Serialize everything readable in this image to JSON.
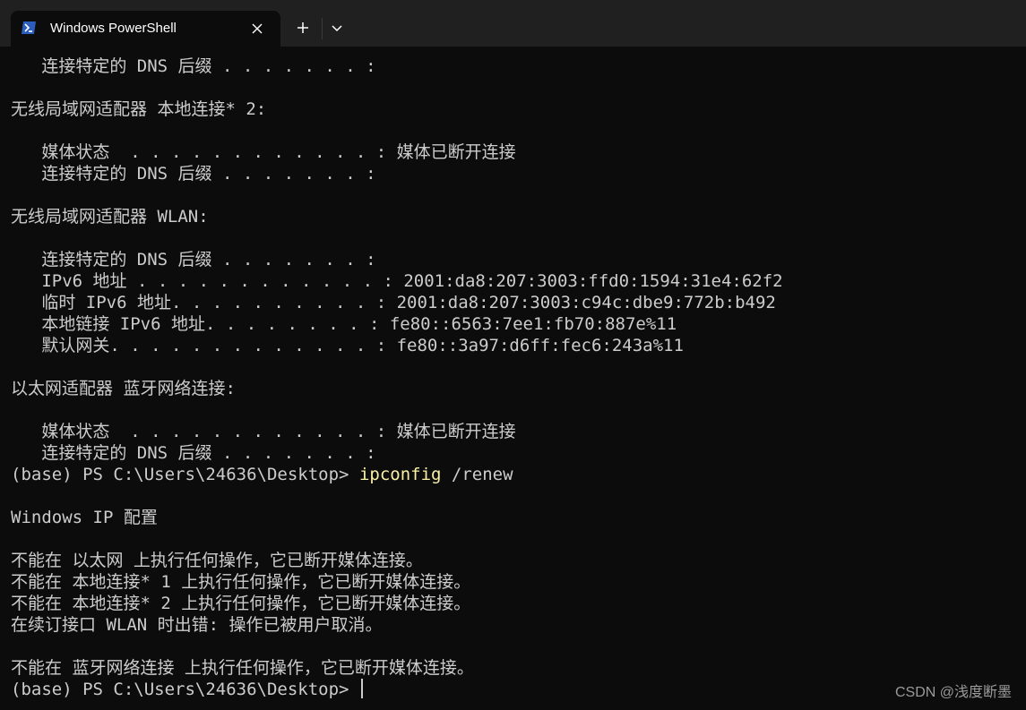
{
  "window": {
    "tab_title": "Windows PowerShell",
    "new_tab_glyph": "+",
    "icons": [
      "powershell-icon",
      "close-icon",
      "plus-icon",
      "chevron-down-icon"
    ],
    "colors": {
      "titlebar": "#202020",
      "terminal_bg": "#0c0c0c",
      "text": "#cccccc",
      "command": "#f9f1a5"
    }
  },
  "terminal": {
    "lines": [
      "   连接特定的 DNS 后缀 . . . . . . . :",
      "",
      "无线局域网适配器 本地连接* 2:",
      "",
      "   媒体状态  . . . . . . . . . . . . : 媒体已断开连接",
      "   连接特定的 DNS 后缀 . . . . . . . :",
      "",
      "无线局域网适配器 WLAN:",
      "",
      "   连接特定的 DNS 后缀 . . . . . . . :",
      "   IPv6 地址 . . . . . . . . . . . . : 2001:da8:207:3003:ffd0:1594:31e4:62f2",
      "   临时 IPv6 地址. . . . . . . . . . : 2001:da8:207:3003:c94c:dbe9:772b:b492",
      "   本地链接 IPv6 地址. . . . . . . . : fe80::6563:7ee1:fb70:887e%11",
      "   默认网关. . . . . . . . . . . . . : fe80::3a97:d6ff:fec6:243a%11",
      "",
      "以太网适配器 蓝牙网络连接:",
      "",
      "   媒体状态  . . . . . . . . . . . . : 媒体已断开连接",
      "   连接特定的 DNS 后缀 . . . . . . . :",
      "",
      "",
      "Windows IP 配置",
      "",
      "不能在 以太网 上执行任何操作，它已断开媒体连接。",
      "不能在 本地连接* 1 上执行任何操作，它已断开媒体连接。",
      "不能在 本地连接* 2 上执行任何操作，它已断开媒体连接。",
      "在续订接口 WLAN 时出错: 操作已被用户取消。",
      "",
      "不能在 蓝牙网络连接 上执行任何操作，它已断开媒体连接。",
      ""
    ],
    "command_line": {
      "prompt": "(base) PS C:\\Users\\24636\\Desktop> ",
      "command": "ipconfig",
      "args": " /renew"
    },
    "final_prompt": "(base) PS C:\\Users\\24636\\Desktop> "
  },
  "watermark": "CSDN @浅度断墨"
}
